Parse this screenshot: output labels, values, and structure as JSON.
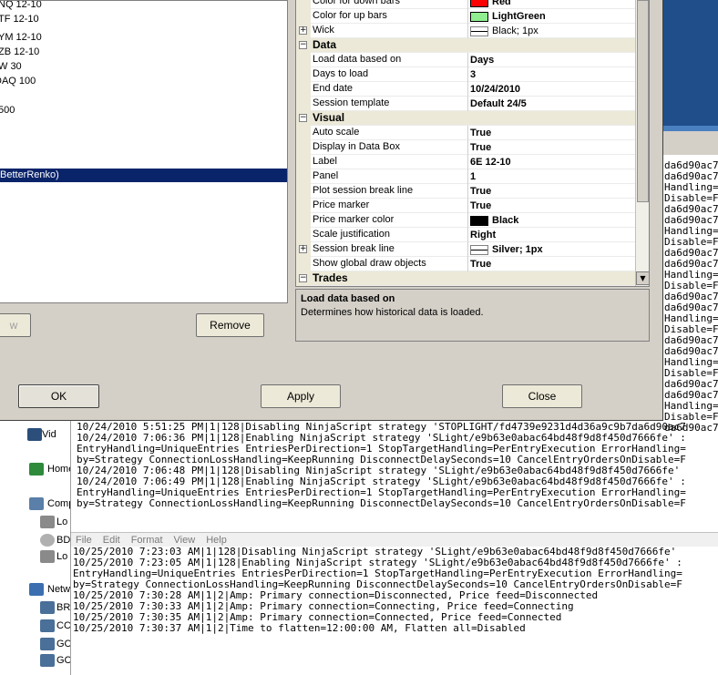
{
  "instruments": [
    {
      "label": "NQ 12-10",
      "top": 0
    },
    {
      "label": "TF 12-10",
      "top": 0
    },
    {
      "label": "YM 12-10",
      "top": 0
    },
    {
      "label": "ZB 12-10",
      "top": 0
    },
    {
      "label": "W 30",
      "top": 0
    },
    {
      "label": "DAQ 100",
      "top": 0
    },
    {
      "label": "500",
      "top": 0
    }
  ],
  "selected_strategy": "BetterRenko)",
  "buttons": {
    "partial_left": "w",
    "remove": "Remove",
    "ok": "OK",
    "apply": "Apply",
    "close": "Close"
  },
  "properties": [
    {
      "type": "prop",
      "name": "Color for down bars",
      "value": "Red",
      "swatch": "#ff0000"
    },
    {
      "type": "prop",
      "name": "Color for up bars",
      "value": "LightGreen",
      "swatch": "#90ee90"
    },
    {
      "type": "prop",
      "name": "Wick",
      "value": "Black; 1px",
      "line": true,
      "expand": true,
      "plain": true
    },
    {
      "type": "cat",
      "name": "Data"
    },
    {
      "type": "prop",
      "name": "Load data based on",
      "value": "Days",
      "selected": true
    },
    {
      "type": "prop",
      "name": "Days to load",
      "value": "3"
    },
    {
      "type": "prop",
      "name": "End date",
      "value": "10/24/2010"
    },
    {
      "type": "prop",
      "name": "Session template",
      "value": "Default 24/5"
    },
    {
      "type": "cat",
      "name": "Visual"
    },
    {
      "type": "prop",
      "name": "Auto scale",
      "value": "True"
    },
    {
      "type": "prop",
      "name": "Display in Data Box",
      "value": "True"
    },
    {
      "type": "prop",
      "name": "Label",
      "value": "6E 12-10"
    },
    {
      "type": "prop",
      "name": "Panel",
      "value": "1"
    },
    {
      "type": "prop",
      "name": "Plot session break line",
      "value": "True"
    },
    {
      "type": "prop",
      "name": "Price marker",
      "value": "True"
    },
    {
      "type": "prop",
      "name": "Price marker color",
      "value": "Black",
      "swatch": "#000000"
    },
    {
      "type": "prop",
      "name": "Scale justification",
      "value": "Right"
    },
    {
      "type": "prop",
      "name": "Session break line",
      "value": "Silver; 1px",
      "line": true,
      "expand": true
    },
    {
      "type": "prop",
      "name": "Show global draw objects",
      "value": "True"
    },
    {
      "type": "cat",
      "name": "Trades"
    }
  ],
  "description": {
    "title": "Load data based on",
    "text": "Determines how historical data is loaded."
  },
  "right_log_fragments": [
    "da6d90ac7",
    "da6d90ac7",
    "Handling=",
    "Disable=F",
    "da6d90ac7",
    "da6d90ac7",
    "Handling=",
    "Disable=F",
    "da6d90ac7",
    "da6d90ac7",
    "Handling=",
    "Disable=F",
    "da6d90ac7",
    "da6d90ac7",
    "Handling=",
    "Disable=F",
    "da6d90ac7",
    "da6d90ac7",
    "Handling=",
    "Disable=F",
    "da6d90ac7",
    "da6d90ac7",
    "Handling=",
    "Disable=F",
    "da6d90ac7"
  ],
  "top_log_lines": [
    "10/24/2010 5:51:25 PM|1|128|Disabling NinjaScript strategy 'STOPLIGHT/fd4739e9231d4d36a9c9b7da6d90ac7",
    "10/24/2010 7:06:36 PM|1|128|Enabling NinjaScript strategy 'SLight/e9b63e0abac64bd48f9d8f450d7666fe' :",
    "EntryHandling=UniqueEntries EntriesPerDirection=1 StopTargetHandling=PerEntryExecution ErrorHandling=",
    "by=Strategy ConnectionLossHandling=KeepRunning DisconnectDelaySeconds=10 CancelEntryOrdersOnDisable=F",
    "10/24/2010 7:06:48 PM|1|128|Disabling NinjaScript strategy 'SLight/e9b63e0abac64bd48f9d8f450d7666fe'",
    "10/24/2010 7:06:49 PM|1|128|Enabling NinjaScript strategy 'SLight/e9b63e0abac64bd48f9d8f450d7666fe' :",
    "EntryHandling=UniqueEntries EntriesPerDirection=1 StopTargetHandling=PerEntryExecution ErrorHandling=",
    "by=Strategy ConnectionLossHandling=KeepRunning DisconnectDelaySeconds=10 CancelEntryOrdersOnDisable=F"
  ],
  "explorer_items": [
    {
      "label": "Vid",
      "icon": "video-icon"
    },
    {
      "label": "Home",
      "icon": "homegroup-icon"
    },
    {
      "label": "Comp",
      "icon": "computer-icon"
    },
    {
      "label": "Lo",
      "icon": "drive-icon"
    },
    {
      "label": "BD",
      "icon": "disc-icon"
    },
    {
      "label": "Lo",
      "icon": "drive-icon"
    },
    {
      "label": "Netw",
      "icon": "network-icon"
    },
    {
      "label": "BR",
      "icon": "network-pc-icon"
    },
    {
      "label": "CC",
      "icon": "network-pc-icon"
    },
    {
      "label": "GC",
      "icon": "network-pc-icon"
    },
    {
      "label": "GC",
      "icon": "network-pc-icon"
    }
  ],
  "notepad_menu": [
    "File",
    "Edit",
    "Format",
    "View",
    "Help"
  ],
  "notepad_lines": [
    "10/25/2010 7:23:03 AM|1|128|Disabling NinjaScript strategy 'SLight/e9b63e0abac64bd48f9d8f450d7666fe'",
    "10/25/2010 7:23:05 AM|1|128|Enabling NinjaScript strategy 'SLight/e9b63e0abac64bd48f9d8f450d7666fe' :",
    "EntryHandling=UniqueEntries EntriesPerDirection=1 StopTargetHandling=PerEntryExecution ErrorHandling=",
    "by=Strategy ConnectionLossHandling=KeepRunning DisconnectDelaySeconds=10 CancelEntryOrdersOnDisable=F",
    "10/25/2010 7:30:28 AM|1|2|Amp: Primary connection=Disconnected, Price feed=Disconnected",
    "10/25/2010 7:30:33 AM|1|2|Amp: Primary connection=Connecting, Price feed=Connecting",
    "10/25/2010 7:30:35 AM|1|2|Amp: Primary connection=Connected, Price feed=Connected",
    "10/25/2010 7:30:37 AM|1|2|Time to flatten=12:00:00 AM, Flatten all=Disabled"
  ]
}
